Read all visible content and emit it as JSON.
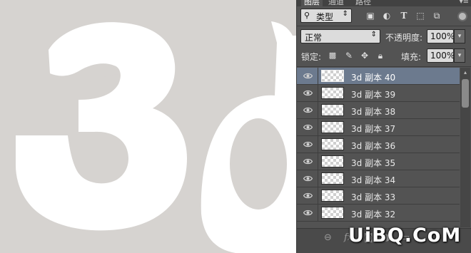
{
  "panel": {
    "tabs": [
      "图层",
      "通道",
      "路径"
    ],
    "menu_icon": "panel-menu-icon",
    "filter": {
      "icon": "search-icon",
      "label": "类型",
      "icons": [
        "image-filter-icon",
        "adjustment-filter-icon",
        "type-filter-icon",
        "shape-filter-icon",
        "smart-object-filter-icon"
      ]
    },
    "blend_mode": "正常",
    "opacity_label": "不透明度:",
    "opacity_value": "100%",
    "lock_label": "锁定:",
    "lock_icons": [
      "lock-transparent-icon",
      "lock-paint-icon",
      "lock-move-icon",
      "lock-all-icon"
    ],
    "fill_label": "填充:",
    "fill_value": "100%",
    "layers": [
      {
        "name": "3d 副本 40",
        "selected": true
      },
      {
        "name": "3d 副本 39",
        "selected": false
      },
      {
        "name": "3d 副本 38",
        "selected": false
      },
      {
        "name": "3d 副本 37",
        "selected": false
      },
      {
        "name": "3d 副本 36",
        "selected": false
      },
      {
        "name": "3d 副本 35",
        "selected": false
      },
      {
        "name": "3d 副本 34",
        "selected": false
      },
      {
        "name": "3d 副本 33",
        "selected": false
      },
      {
        "name": "3d 副本 32",
        "selected": false
      }
    ],
    "bottom_icons": [
      "link-layers-icon",
      "fx-icon",
      "mask-icon",
      "adjustment-icon",
      "group-icon"
    ]
  },
  "canvas": {
    "background": "#d6d3d0",
    "shape_color": "#ffffff"
  },
  "watermark": "UiBQ.CoM"
}
